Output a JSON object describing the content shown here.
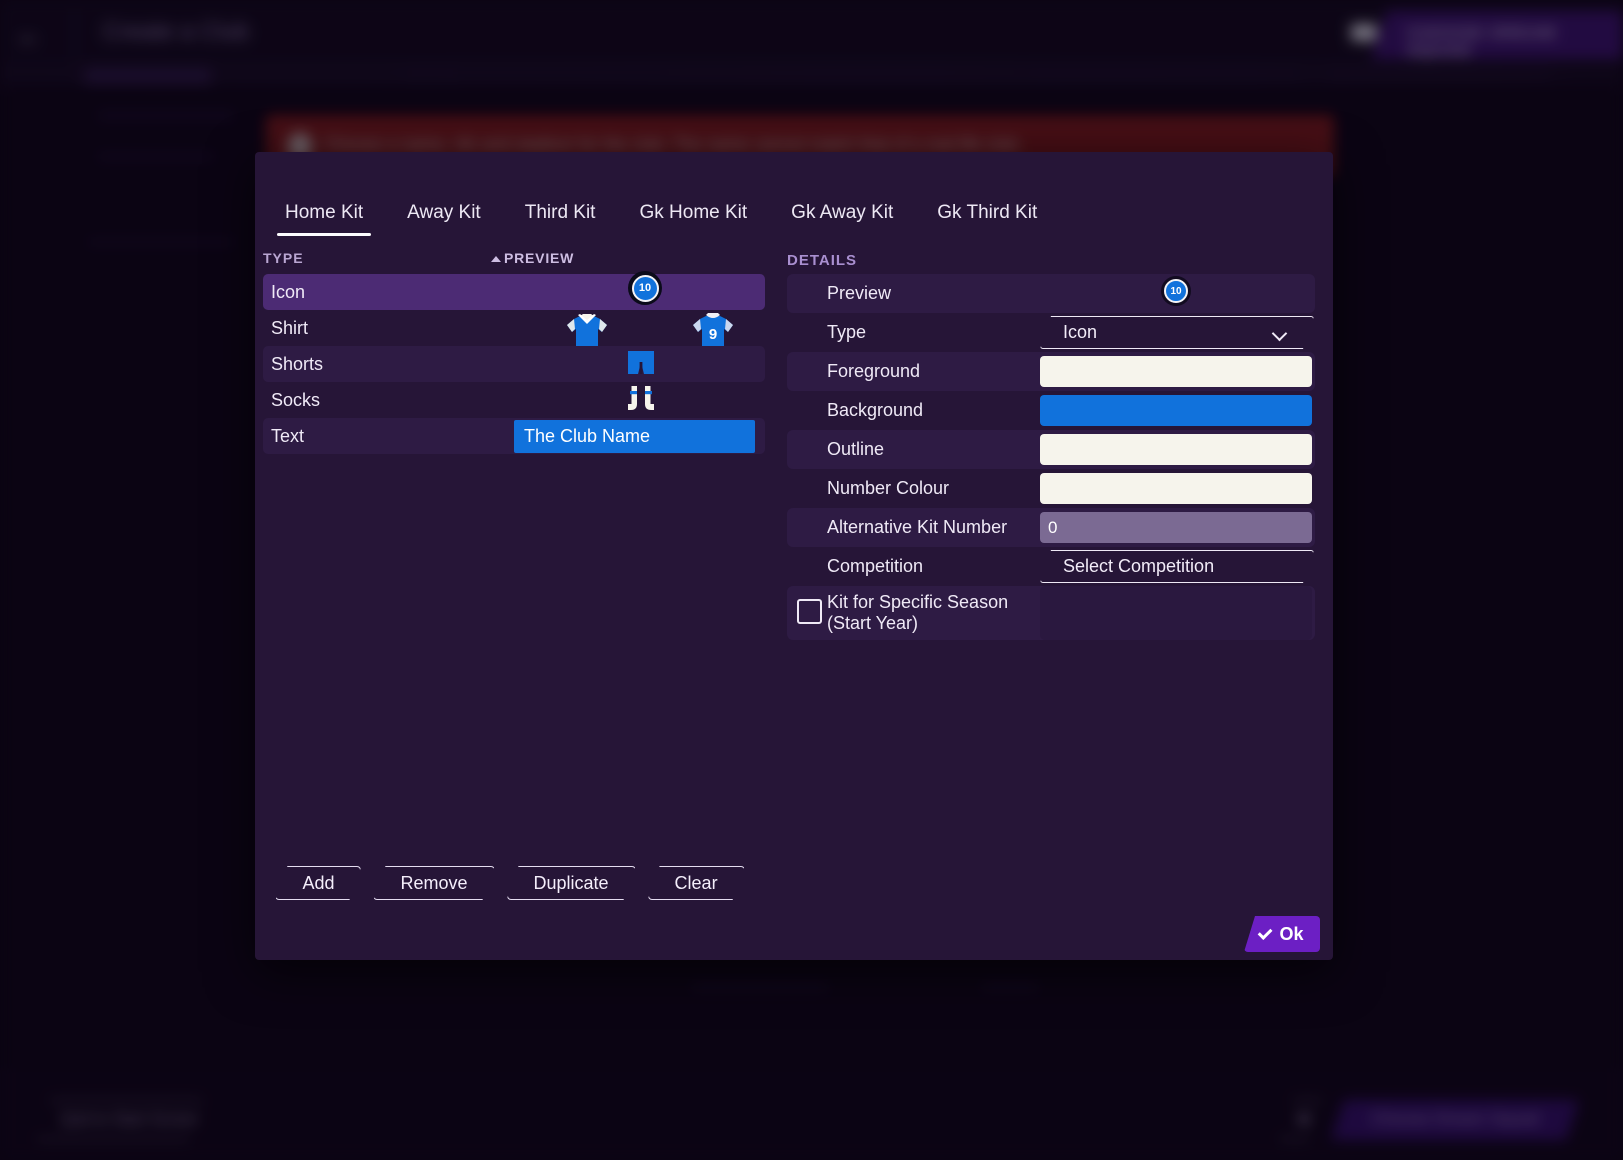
{
  "background": {
    "title": "Create a Club",
    "back_icon": "arrow-left-icon",
    "flag_caret_icon": "chevron-down-icon",
    "dream_squad_top_label": "CHOOSE DREAM SQUAD",
    "alert_text": "Choose a name, nfo and stadium for the club. The name cannot match that of a real life club.",
    "alert_icon": "warning-icon",
    "alert_color": "#7e1b1b",
    "quit_label": "Quit to Start Screen",
    "squad_back_icon": "arrow-left-icon",
    "dream_squad_bottom_label": "Choose Dream Squad"
  },
  "dialog": {
    "tabs": [
      {
        "label": "Home Kit",
        "active": true
      },
      {
        "label": "Away Kit",
        "active": false
      },
      {
        "label": "Third Kit",
        "active": false
      },
      {
        "label": "Gk Home Kit",
        "active": false
      },
      {
        "label": "Gk Away Kit",
        "active": false
      },
      {
        "label": "Gk Third Kit",
        "active": false
      }
    ],
    "columns": {
      "type": "TYPE",
      "preview": "PREVIEW",
      "preview_sort_icon": "sort-ascending-icon",
      "details": "DETAILS"
    },
    "kit_rows": [
      {
        "label": "Icon",
        "preview": "badge",
        "selected": true
      },
      {
        "label": "Shirt",
        "preview": "shirts",
        "selected": false
      },
      {
        "label": "Shorts",
        "preview": "shorts",
        "selected": false
      },
      {
        "label": "Socks",
        "preview": "socks",
        "selected": false
      },
      {
        "label": "Text",
        "preview": "text",
        "selected": false
      }
    ],
    "preview": {
      "badge_number": "10",
      "back_shirt_number": "9",
      "text_value": "The Club Name",
      "kit_colour": "#1172dc",
      "trim_colour": "#f6f4ec"
    },
    "details": [
      {
        "label": "Preview",
        "field": "badge",
        "value": "10"
      },
      {
        "label": "Type",
        "field": "select",
        "value": "Icon"
      },
      {
        "label": "Foreground",
        "field": "swatch",
        "value": "#f6f4ec"
      },
      {
        "label": "Background",
        "field": "swatch",
        "value": "#1172dc"
      },
      {
        "label": "Outline",
        "field": "swatch",
        "value": "#f6f4ec"
      },
      {
        "label": "Number Colour",
        "field": "swatch",
        "value": "#f6f4ec"
      },
      {
        "label": "Alternative Kit Number",
        "field": "number",
        "value": "0"
      },
      {
        "label": "Competition",
        "field": "select",
        "value": "Select Competition"
      },
      {
        "label": "Kit for Specific Season (Start Year)",
        "field": "checkbox",
        "value": "",
        "checked": false
      }
    ],
    "actions": [
      {
        "label": "Add"
      },
      {
        "label": "Remove"
      },
      {
        "label": "Duplicate"
      },
      {
        "label": "Clear"
      }
    ],
    "ok": {
      "label": "Ok",
      "icon": "check-icon",
      "colour": "#6c1fc4"
    }
  }
}
